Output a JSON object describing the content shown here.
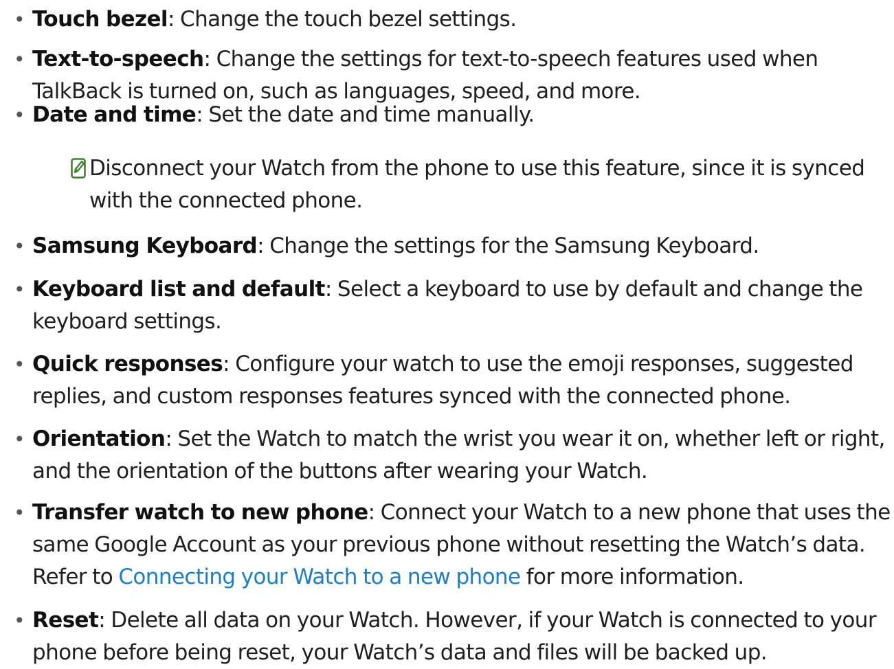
{
  "items": [
    {
      "term": "Touch bezel",
      "lines": [
        ": Change the touch bezel settings."
      ]
    },
    {
      "term": "Text-to-speech",
      "lines": [
        ": Change the settings for text-to-speech features used when",
        "TalkBack is turned on, such as languages, speed, and more."
      ]
    },
    {
      "term": "Date and time",
      "lines": [
        ": Set the date and time manually."
      ]
    },
    {
      "term": "Samsung Keyboard",
      "lines": [
        ": Change the settings for the Samsung Keyboard."
      ]
    },
    {
      "term": "Keyboard list and default",
      "lines": [
        ": Select a keyboard to use by default and change the",
        "keyboard settings."
      ]
    },
    {
      "term": "Quick responses",
      "lines": [
        ": Configure your watch to use the emoji responses, suggested",
        "replies, and custom responses features synced with the connected phone."
      ]
    },
    {
      "term": "Orientation",
      "lines": [
        ": Set the Watch to match the wrist you wear it on, whether left or right,",
        "and the orientation of the buttons after wearing your Watch."
      ]
    },
    {
      "term": "Transfer watch to new phone",
      "lines": [
        ": Connect your Watch to a new phone that uses the",
        "same Google Account as your previous phone without resetting the Watch’s data."
      ],
      "line3_prefix": "Refer to ",
      "link": "Connecting your Watch to a new phone",
      "line3_suffix": " for more information."
    },
    {
      "term": "Reset",
      "lines": [
        ": Delete all data on your Watch. However, if your Watch is connected to your",
        "phone before being reset, your Watch’s data and files will be backed up."
      ]
    }
  ],
  "note": {
    "icon": "note-pencil-icon",
    "icon_color": "#3a7d2c",
    "lines": [
      "Disconnect your Watch from the phone to use this feature, since it is synced",
      "with the connected phone."
    ]
  },
  "bullet": "•",
  "link_color": "#1c7fc6"
}
